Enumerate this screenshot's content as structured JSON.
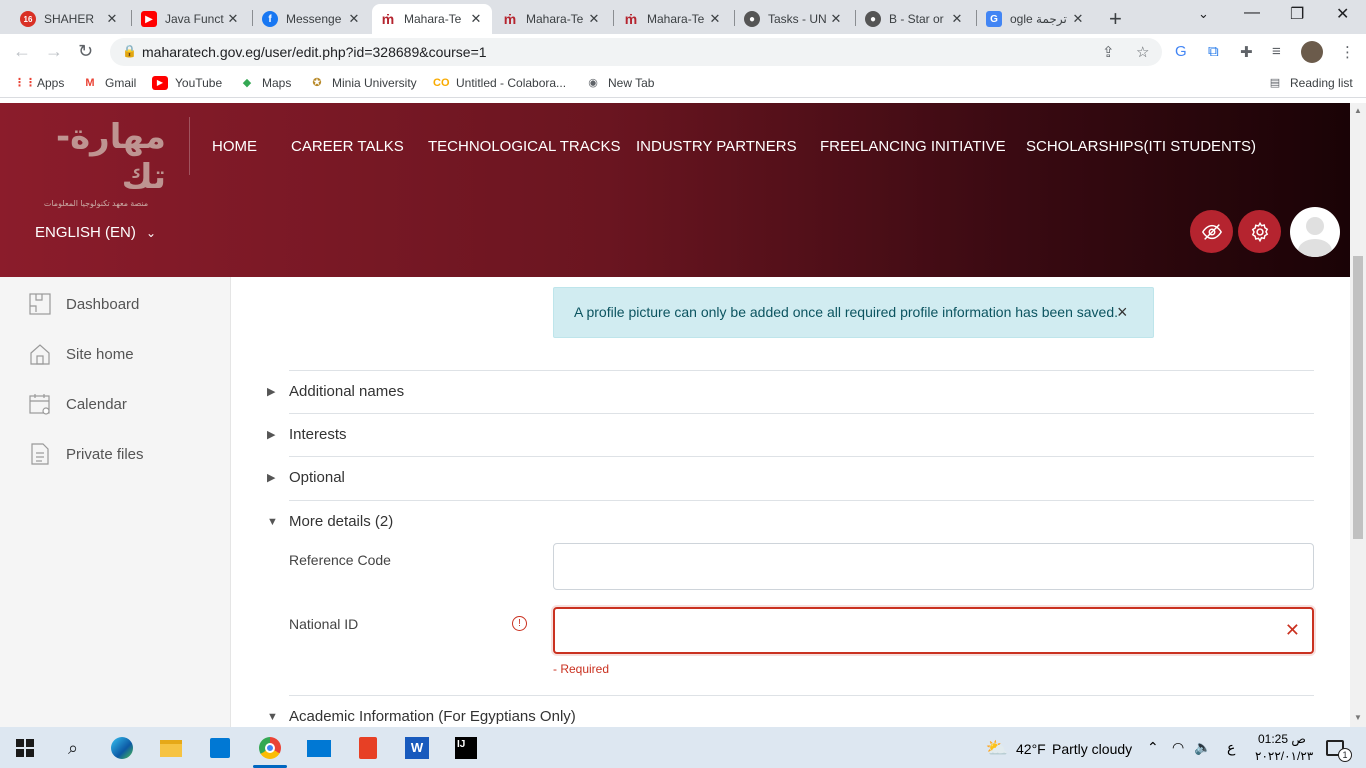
{
  "browser": {
    "tabs": [
      {
        "title": "SHAHER",
        "icon": "notification-badge-icon",
        "badge": "16",
        "active": false
      },
      {
        "title": "Java Funct",
        "icon": "youtube-icon",
        "active": false
      },
      {
        "title": "Messenge",
        "icon": "facebook-icon",
        "active": false
      },
      {
        "title": "Mahara-Te",
        "icon": "mahara-icon",
        "active": true
      },
      {
        "title": "Mahara-Te",
        "icon": "mahara-icon",
        "active": false
      },
      {
        "title": "Mahara-Te",
        "icon": "mahara-icon",
        "active": false
      },
      {
        "title": "Tasks - UN",
        "icon": "github-icon",
        "active": false
      },
      {
        "title": "B - Star or",
        "icon": "github-icon",
        "active": false
      },
      {
        "title": "ogle ترجمة",
        "icon": "google-translate-icon",
        "active": false
      }
    ],
    "url": "maharatech.gov.eg/user/edit.php?id=328689&course=1",
    "bookmarks": [
      {
        "label": "Apps",
        "icon": "apps-grid-icon"
      },
      {
        "label": "Gmail",
        "icon": "gmail-icon"
      },
      {
        "label": "YouTube",
        "icon": "youtube-icon"
      },
      {
        "label": "Maps",
        "icon": "maps-icon"
      },
      {
        "label": "Minia University",
        "icon": "university-icon"
      },
      {
        "label": "Untitled - Colabora...",
        "icon": "colab-icon"
      },
      {
        "label": "New Tab",
        "icon": "globe-icon"
      }
    ],
    "reading_list": "Reading list"
  },
  "site": {
    "logo_text": "مهارة-تك",
    "logo_sub": "منصة معهد تكنولوجيا المعلومات",
    "nav": [
      "HOME",
      "CAREER TALKS",
      "TECHNOLOGICAL TRACKS",
      "INDUSTRY PARTNERS",
      "FREELANCING INITIATIVE",
      "SCHOLARSHIPS(ITI STUDENTS)"
    ],
    "language": "ENGLISH (EN)"
  },
  "drawer": [
    {
      "label": "Dashboard",
      "icon": "puzzle-icon"
    },
    {
      "label": "Site home",
      "icon": "home-icon"
    },
    {
      "label": "Calendar",
      "icon": "calendar-icon"
    },
    {
      "label": "Private files",
      "icon": "file-icon"
    }
  ],
  "alert": {
    "message": "A profile picture can only be added once all required profile information has been saved."
  },
  "sections": {
    "additional_names": "Additional names",
    "interests": "Interests",
    "optional": "Optional",
    "more_details": "More details (2)",
    "academic": "Academic Information (For Egyptians Only)"
  },
  "fields": {
    "reference_code": {
      "label": "Reference Code",
      "value": ""
    },
    "national_id": {
      "label": "National ID",
      "value": "",
      "error": "- Required"
    }
  },
  "taskbar": {
    "weather_temp": "42°F",
    "weather_desc": "Partly cloudy",
    "time": "01:25 ص",
    "date": "٢٠٢٢/٠١/٢٣",
    "lang_indicator": "ع",
    "notification_count": "1"
  }
}
